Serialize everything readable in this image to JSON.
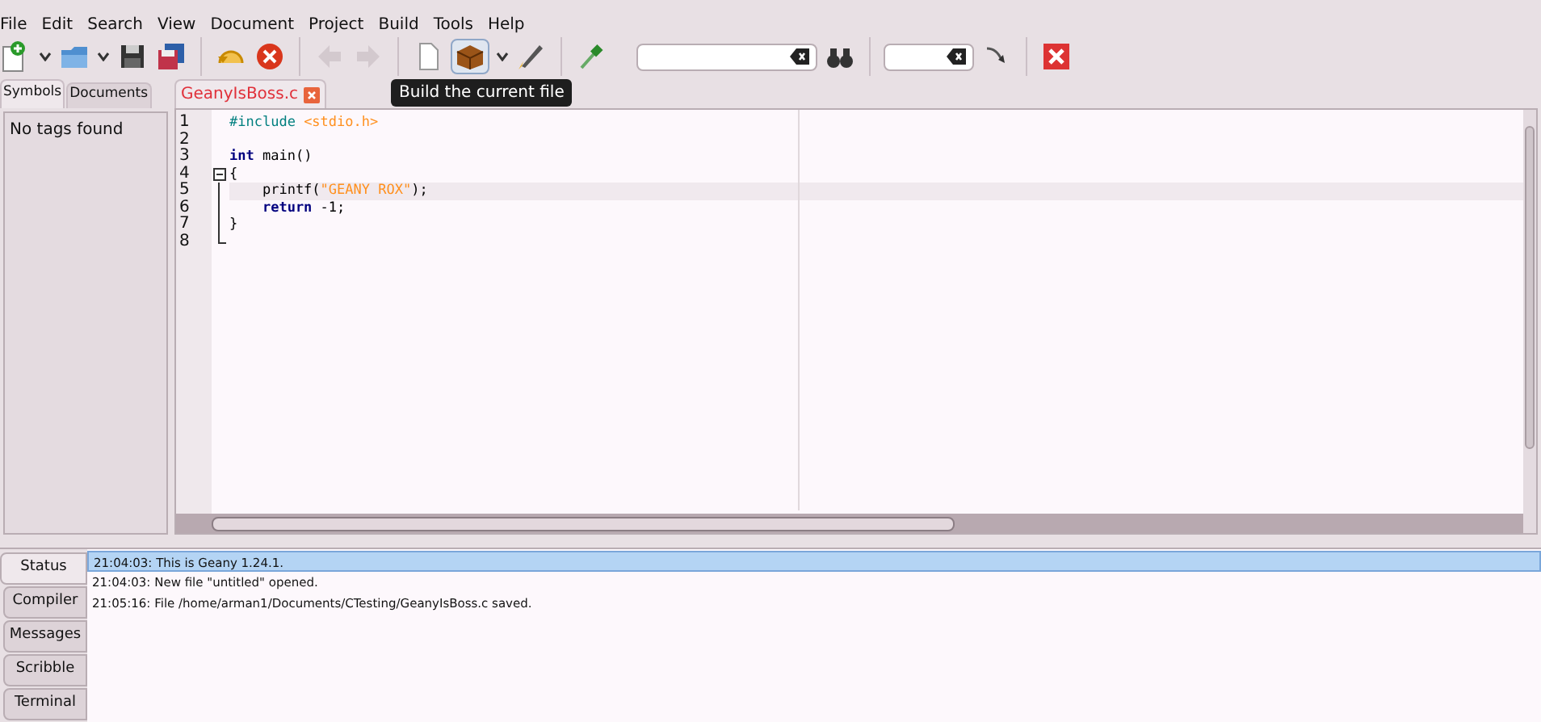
{
  "menu": [
    "File",
    "Edit",
    "Search",
    "View",
    "Document",
    "Project",
    "Build",
    "Tools",
    "Help"
  ],
  "toolbar": {
    "tooltip": "Build the current file",
    "hovered_build": true
  },
  "sidebar": {
    "tabs": [
      {
        "label": "Symbols",
        "selected": true
      },
      {
        "label": "Documents",
        "selected": false
      }
    ],
    "message": "No tags found"
  },
  "editor": {
    "tabs": [
      {
        "label": "GeanyIsBoss.c",
        "selected": true
      }
    ],
    "lines": [
      {
        "number": "1",
        "kind": "plain",
        "tokens": [
          {
            "kind": "preproc",
            "text": "#include "
          },
          {
            "kind": "string",
            "text": "<stdio.h>"
          }
        ]
      },
      {
        "number": "2",
        "kind": "plain"
      },
      {
        "number": "3",
        "kind": "plain",
        "tokens": [
          {
            "kind": "keyword",
            "text": "int"
          },
          {
            "kind": "plain",
            "text": " main()"
          }
        ]
      },
      {
        "number": "4",
        "kind": "foldstart",
        "tokens": [
          {
            "kind": "plain",
            "text": "{"
          }
        ]
      },
      {
        "number": "5",
        "kind": "foldbody",
        "tokens": [
          {
            "kind": "plain",
            "text": "    printf("
          },
          {
            "kind": "string",
            "text": "\"GEANY ROX\""
          },
          {
            "kind": "plain",
            "text": ");"
          }
        ]
      },
      {
        "number": "6",
        "kind": "foldbody",
        "tokens": [
          {
            "kind": "keyword",
            "text": "    return"
          },
          {
            "kind": "plain",
            "text": " -1;"
          }
        ]
      },
      {
        "number": "7",
        "kind": "foldbody",
        "tokens": [
          {
            "kind": "plain",
            "text": "}"
          }
        ]
      },
      {
        "number": "8",
        "kind": "foldend"
      }
    ]
  },
  "bottom": {
    "tabs": [
      {
        "label": "Status",
        "selected": true
      },
      {
        "label": "Compiler",
        "selected": false
      },
      {
        "label": "Messages",
        "selected": false
      },
      {
        "label": "Scribble",
        "selected": false
      },
      {
        "label": "Terminal",
        "selected": false
      }
    ],
    "messages": [
      {
        "text": "21:04:03: This is Geany 1.24.1.",
        "selected": true
      },
      {
        "text": "21:04:03: New file \"untitled\" opened.",
        "selected": false
      },
      {
        "text": "21:05:16: File /home/arman1/Documents/CTesting/GeanyIsBoss.c saved.",
        "selected": false
      }
    ]
  }
}
